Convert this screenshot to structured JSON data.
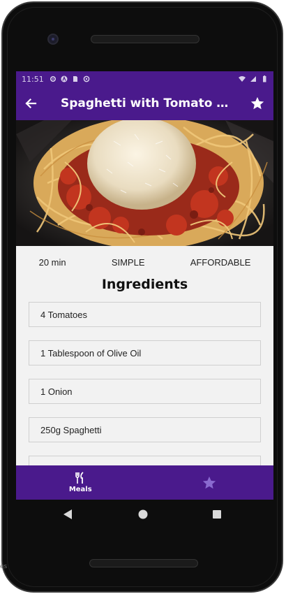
{
  "status_bar": {
    "time": "11:51"
  },
  "app_bar": {
    "title": "Spaghetti with Tomato Sauce"
  },
  "meal_info": {
    "duration": "20 min",
    "complexity": "SIMPLE",
    "affordability": "AFFORDABLE"
  },
  "ingredients": {
    "heading": "Ingredients",
    "items": [
      "4 Tomatoes",
      "1 Tablespoon of Olive Oil",
      "1 Onion",
      "250g Spaghetti",
      ""
    ]
  },
  "bottom_nav": {
    "meals_label": "Meals"
  },
  "side_label": "es",
  "colors": {
    "primary": "#4a1a8c",
    "accent_star": "#8a6ad0",
    "screen_bg": "#f2f2f2"
  },
  "icons": [
    "back-arrow-icon",
    "star-icon",
    "cutlery-icon",
    "star-tab-icon",
    "back-triangle-icon",
    "home-circle-icon",
    "recents-square-icon"
  ]
}
